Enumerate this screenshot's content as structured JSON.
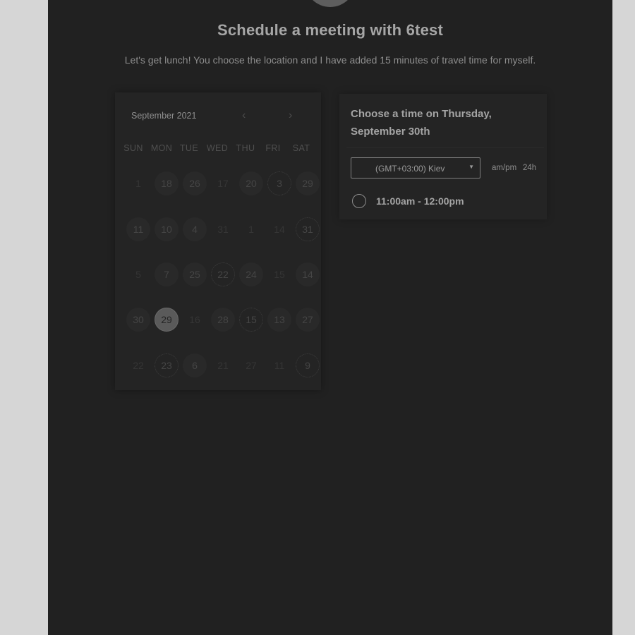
{
  "header": {
    "title": "Schedule a meeting with 6test",
    "subtitle": "Let's get lunch! You choose the location and I have added 15 minutes of travel time for myself."
  },
  "calendar": {
    "month_label": "September 2021",
    "prev_icon": "chevron-left-icon",
    "next_icon": "chevron-right-icon",
    "weekdays": [
      "SUN",
      "MON",
      "TUE",
      "WED",
      "THU",
      "FRI",
      "SAT"
    ],
    "weeks": [
      [
        "1",
        "18",
        "26",
        "17",
        "20",
        "3",
        "29"
      ],
      [
        "11",
        "10",
        "4",
        "31",
        "1",
        "14",
        "31"
      ],
      [
        "5",
        "7",
        "25",
        "22",
        "24",
        "15",
        "14"
      ],
      [
        "30",
        "29",
        "16",
        "28",
        "15",
        "13",
        "27"
      ],
      [
        "22",
        "23",
        "6",
        "21",
        "27",
        "11",
        "9"
      ]
    ],
    "selected_day": "29"
  },
  "time_panel": {
    "heading": "Choose a time on Thursday, September 30th",
    "timezone": "(GMT+03:00) Kiev",
    "format_ampm": "am/pm",
    "format_24h": "24h",
    "slots": [
      "11:00am - 12:00pm"
    ]
  },
  "colors": {
    "page_background": "#d6d6d6",
    "panel_background": "#212121"
  }
}
